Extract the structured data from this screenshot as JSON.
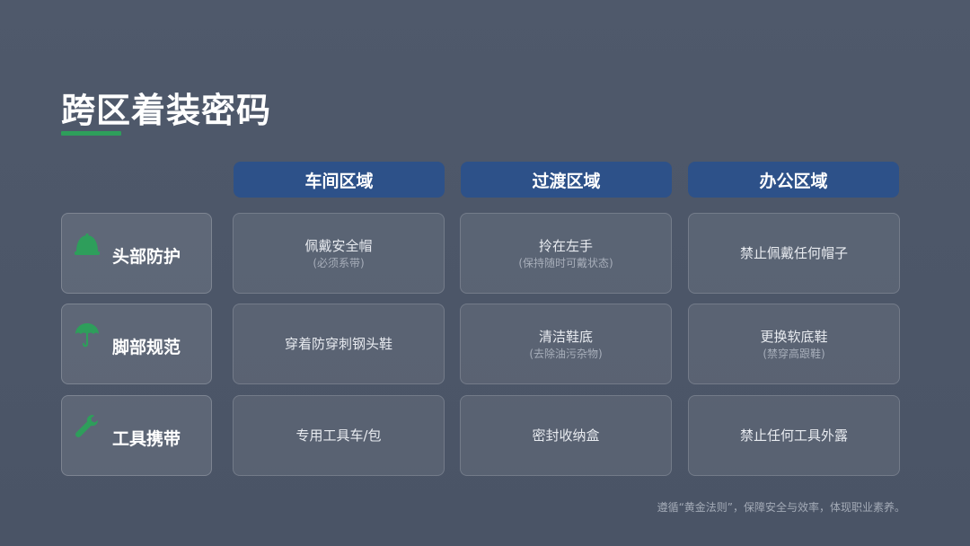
{
  "title": "跨区着装密码",
  "accent_color": "#2e9e5b",
  "header_color": "#2d5189",
  "columns": [
    "车间区域",
    "过渡区域",
    "办公区域"
  ],
  "rows": [
    {
      "label": "头部防护",
      "icon": "helmet-icon",
      "cells": [
        {
          "main": "佩戴安全帽",
          "sub": "(必须系带)"
        },
        {
          "main": "拎在左手",
          "sub": "(保持随时可戴状态)"
        },
        {
          "main": "禁止佩戴任何帽子",
          "sub": ""
        }
      ]
    },
    {
      "label": "脚部规范",
      "icon": "umbrella-icon",
      "cells": [
        {
          "main": "穿着防穿刺钢头鞋",
          "sub": ""
        },
        {
          "main": "清洁鞋底",
          "sub": "(去除油污杂物)"
        },
        {
          "main": "更换软底鞋",
          "sub": "(禁穿高跟鞋)"
        }
      ]
    },
    {
      "label": "工具携带",
      "icon": "wrench-icon",
      "cells": [
        {
          "main": "专用工具车/包",
          "sub": ""
        },
        {
          "main": "密封收纳盒",
          "sub": ""
        },
        {
          "main": "禁止任何工具外露",
          "sub": ""
        }
      ]
    }
  ],
  "footer": "遵循“黄金法则”，保障安全与效率，体现职业素养。"
}
